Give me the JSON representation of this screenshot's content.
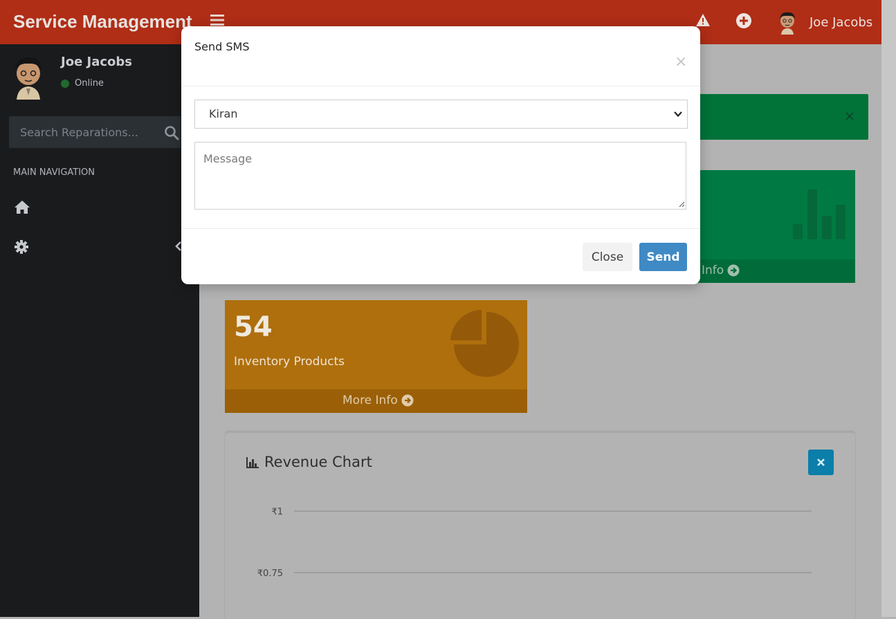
{
  "navbar": {
    "brand": "Service Management",
    "user_name": "Joe Jacobs"
  },
  "sidebar": {
    "user_name": "Joe Jacobs",
    "status": "Online",
    "search_placeholder": "Search Reparations...",
    "section_header": "MAIN NAVIGATION",
    "items": [
      {
        "icon": "home-icon"
      },
      {
        "icon": "gear-icon"
      }
    ]
  },
  "info_boxes": {
    "green": {
      "more_label": "Info"
    },
    "orange": {
      "count": "54",
      "label": "Inventory Products",
      "more_label": "More Info"
    }
  },
  "chart_card": {
    "title": "Revenue Chart",
    "y_ticks": [
      "₹1",
      "₹0.75"
    ]
  },
  "chart_data": {
    "type": "line",
    "title": "Revenue Chart",
    "y_tick_labels": [
      "₹1",
      "₹0.75"
    ],
    "series": []
  },
  "modal": {
    "title": "Send SMS",
    "close_symbol": "×",
    "recipient_selected": "Kiran",
    "message_placeholder": "Message",
    "close_label": "Close",
    "send_label": "Send"
  },
  "colors": {
    "navbar": "#b02d16",
    "sidebar": "#1a1b1d",
    "green_box": "#007a42",
    "orange_box": "#af6f0d",
    "send_button": "#3f8ac5",
    "chart_close_button": "#0b7eaa"
  }
}
